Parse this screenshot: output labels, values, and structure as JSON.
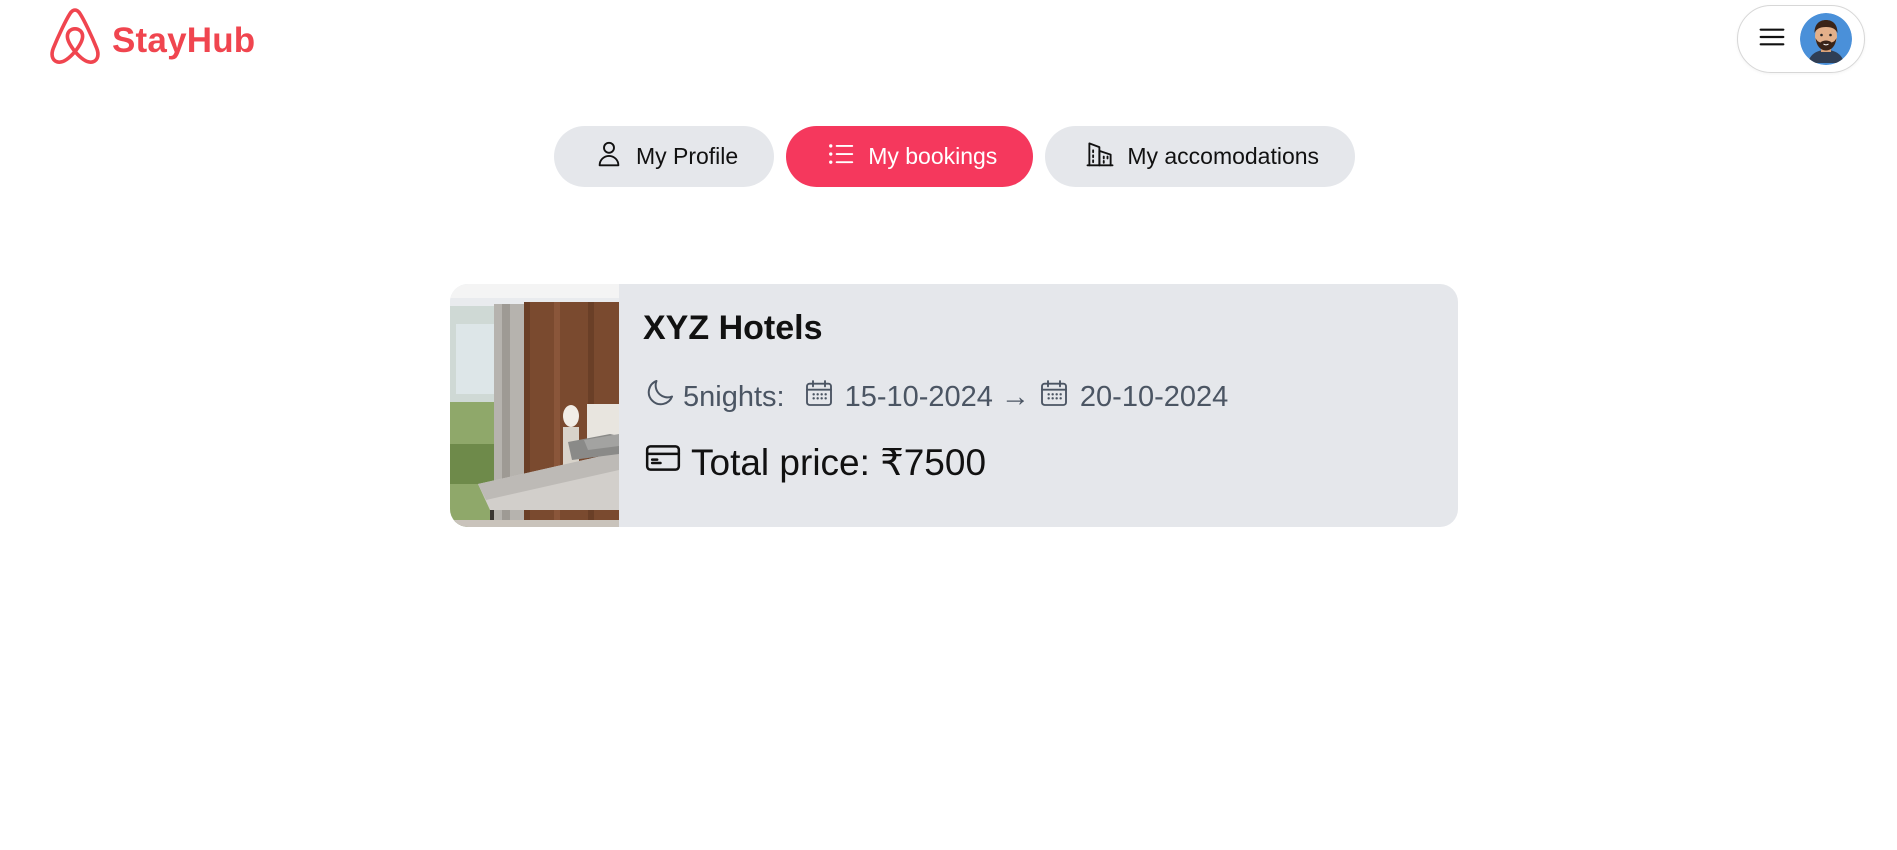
{
  "header": {
    "brand": "StayHub",
    "brand_color": "#f0454f",
    "logo_icon": "airbnb-logo-icon",
    "menu_icon": "hamburger-menu-icon",
    "avatar": "user-avatar"
  },
  "tabs": [
    {
      "label": "My Profile",
      "icon": "user-icon",
      "active": false
    },
    {
      "label": "My bookings",
      "icon": "list-icon",
      "active": true
    },
    {
      "label": "My accomodations",
      "icon": "building-icon",
      "active": false
    }
  ],
  "accent_color": "#f5385d",
  "bookings": [
    {
      "title": "XYZ Hotels",
      "nights": "5nights:",
      "check_in": "15-10-2024",
      "arrow": "→",
      "check_out": "20-10-2024",
      "price_text": "Total price: ₹7500"
    }
  ]
}
